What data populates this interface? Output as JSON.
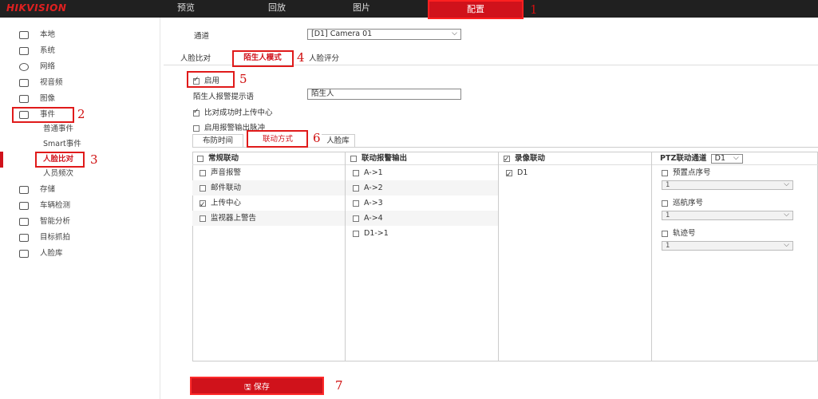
{
  "logo": "HIKVISION",
  "nav": [
    "预览",
    "回放",
    "图片",
    "配置"
  ],
  "sidebar": {
    "items": [
      "本地",
      "系统",
      "网络",
      "视音频",
      "图像",
      "事件"
    ],
    "sub_items": [
      "普通事件",
      "Smart事件",
      "人脸比对",
      "人员频次"
    ],
    "items_after": [
      "存储",
      "车辆检测",
      "智能分析",
      "目标抓拍",
      "人脸库"
    ]
  },
  "channel": {
    "label": "通道",
    "value": "[D1] Camera 01"
  },
  "tabs": [
    "人脸比对",
    "陌生人模式",
    "人脸评分"
  ],
  "enable_label": "启用",
  "stranger_prompt": {
    "label": "陌生人报警提示语",
    "value": "陌生人"
  },
  "upload_on_match": "比对成功时上传中心",
  "enable_alarm_pulse": "启用报警输出脉冲",
  "subtabs": [
    "布防时间",
    "联动方式",
    "人脸库"
  ],
  "link_table": {
    "normal": {
      "header": "常规联动",
      "items": [
        "声音报警",
        "邮件联动",
        "上传中心",
        "监视器上警告"
      ],
      "checked": [
        false,
        false,
        true,
        false
      ]
    },
    "alarm_output": {
      "header": "联动报警输出",
      "items": [
        "A->1",
        "A->2",
        "A->3",
        "A->4",
        "D1->1"
      ]
    },
    "recording": {
      "header": "录像联动",
      "items": [
        "D1"
      ]
    },
    "ptz": {
      "header": "PTZ联动通道",
      "channel": "D1",
      "items": [
        "预置点序号",
        "巡航序号",
        "轨迹号"
      ],
      "value": "1"
    }
  },
  "save_label": "保存",
  "annotations": [
    "1",
    "2",
    "3",
    "4",
    "5",
    "6",
    "7"
  ],
  "colors": {
    "accent": "#d0121b",
    "topbar": "#202020"
  }
}
